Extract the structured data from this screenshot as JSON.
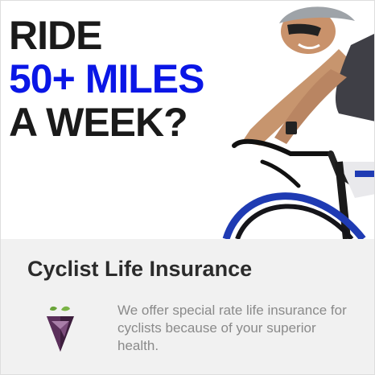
{
  "hero": {
    "headline_line1": "RIDE",
    "headline_line2": "50+ MILES",
    "headline_line3": "A WEEK?",
    "headline_colors": {
      "primary": "#1a1a1a",
      "accent": "#0a16e6"
    },
    "image": "cyclist-photo"
  },
  "section": {
    "title": "Cyclist Life Insurance",
    "logo_icon": "shield-leaf-logo-icon",
    "description": "We offer special rate life insurance for cyclists because of your superior health.",
    "background_color": "#f1f1f1"
  }
}
